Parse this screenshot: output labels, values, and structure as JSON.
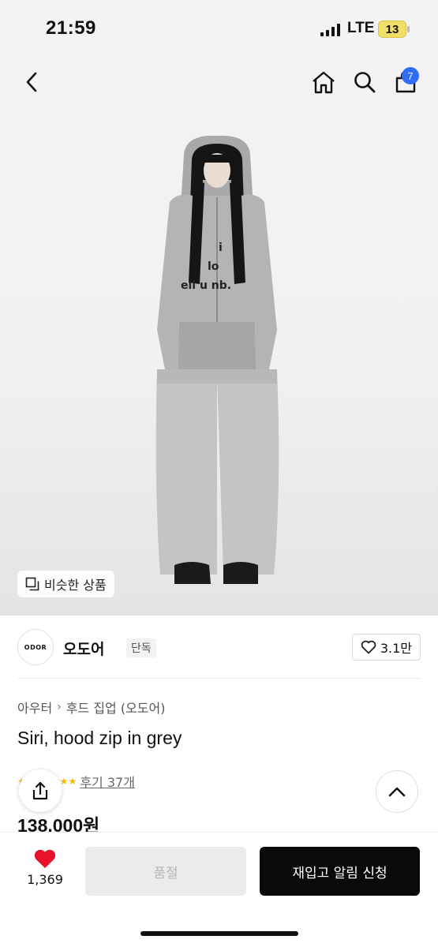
{
  "status_bar": {
    "time": "21:59",
    "network": "LTE",
    "battery": "13",
    "icons": [
      "signal-icon",
      "battery-icon"
    ]
  },
  "nav": {
    "icons": [
      "back-icon",
      "home-icon",
      "search-icon",
      "cart-icon"
    ],
    "cart_badge": "7",
    "accent_color": "#2f6ef5"
  },
  "hero": {
    "similar_button_label": "비슷한 상품"
  },
  "brand": {
    "logo_text": "ODOR",
    "name": "오도어",
    "tag": "단독",
    "like_count": "3.1만"
  },
  "product": {
    "breadcrumb": [
      "아우터",
      "후드 집업 (오도어)"
    ],
    "title": "Siri, hood zip in grey",
    "review_link": "후기 37개",
    "price": "138,000원"
  },
  "bottom_bar": {
    "wish_count": "1,369",
    "soldout_label": "품절",
    "restock_label": "재입고 알림 신청",
    "heart_color": "#e8132b"
  }
}
